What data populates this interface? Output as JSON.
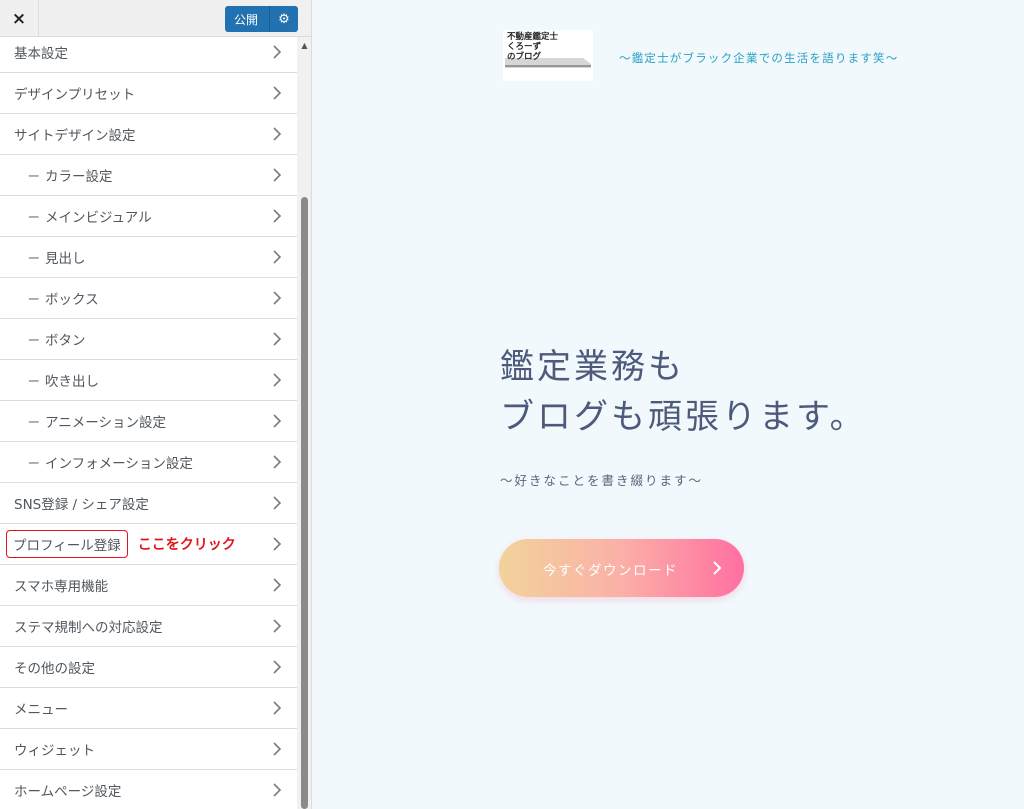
{
  "sidebar": {
    "close_icon": "×",
    "publish_label": "公開",
    "gear_icon": "⚙",
    "scroll_up_icon": "▲",
    "items": [
      {
        "label": "基本設定",
        "sub": false
      },
      {
        "label": "デザインプリセット",
        "sub": false
      },
      {
        "label": "サイトデザイン設定",
        "sub": false
      },
      {
        "label": "カラー設定",
        "sub": true
      },
      {
        "label": "メインビジュアル",
        "sub": true
      },
      {
        "label": "見出し",
        "sub": true
      },
      {
        "label": "ボックス",
        "sub": true
      },
      {
        "label": "ボタン",
        "sub": true
      },
      {
        "label": "吹き出し",
        "sub": true
      },
      {
        "label": "アニメーション設定",
        "sub": true
      },
      {
        "label": "インフォメーション設定",
        "sub": true
      },
      {
        "label": "SNS登録 / シェア設定",
        "sub": false
      },
      {
        "label": "プロフィール登録",
        "sub": false,
        "highlight": true
      },
      {
        "label": "スマホ専用機能",
        "sub": false
      },
      {
        "label": "ステマ規制への対応設定",
        "sub": false
      },
      {
        "label": "その他の設定",
        "sub": false
      },
      {
        "label": "メニュー",
        "sub": false
      },
      {
        "label": "ウィジェット",
        "sub": false
      },
      {
        "label": "ホームページ設定",
        "sub": false
      }
    ],
    "sub_dash": "－",
    "annotation": "ここをクリック"
  },
  "preview": {
    "logo_lines": [
      "不動産鑑定士",
      "くろーず",
      "のブログ"
    ],
    "tagline": "～鑑定士がブラック企業での生活を語ります笑～",
    "hero_line1": "鑑定業務も",
    "hero_line2": "ブログも頑張ります。",
    "hero_sub": "～好きなことを書き綴ります～",
    "cta_label": "今すぐダウンロード"
  },
  "colors": {
    "publish_bg": "#2271b1",
    "annotation": "#e0141b",
    "tagline": "#2aa0c5",
    "hero_text": "#4e5a7c",
    "cta_gradient_start": "#f2d39a",
    "cta_gradient_end": "#ff6fa0"
  }
}
